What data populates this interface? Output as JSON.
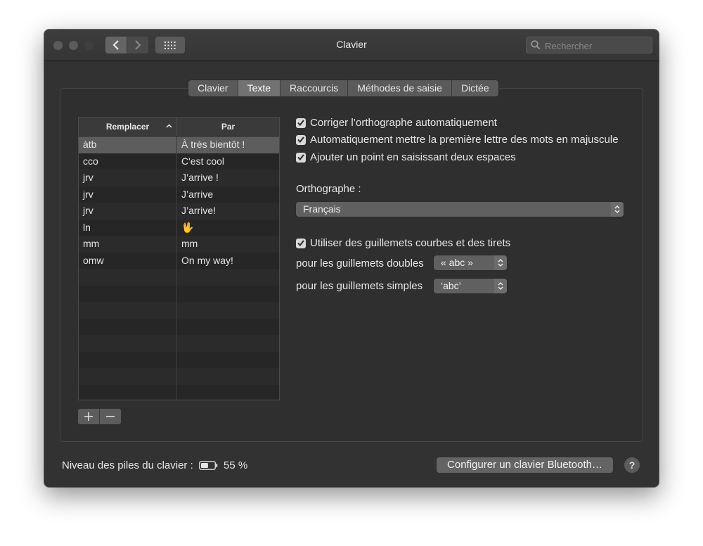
{
  "window": {
    "title": "Clavier"
  },
  "toolbar": {
    "search_placeholder": "Rechercher",
    "icons": [
      "chevron-left-icon",
      "chevron-right-icon",
      "grid-icon",
      "search-icon"
    ]
  },
  "tabs": [
    {
      "label": "Clavier",
      "active": false
    },
    {
      "label": "Texte",
      "active": true
    },
    {
      "label": "Raccourcis",
      "active": false
    },
    {
      "label": "Méthodes de saisie",
      "active": false
    },
    {
      "label": "Dictée",
      "active": false
    }
  ],
  "table": {
    "headers": {
      "replace": "Remplacer",
      "with": "Par"
    },
    "rows": [
      {
        "replace": "àtb",
        "with": "À très bientôt !",
        "selected": true
      },
      {
        "replace": "cco",
        "with": "C'est cool",
        "selected": false
      },
      {
        "replace": "jrv",
        "with": "J’arrive !",
        "selected": false
      },
      {
        "replace": "jrv",
        "with": "J’arrive",
        "selected": false
      },
      {
        "replace": "jrv",
        "with": "J’arrive!",
        "selected": false
      },
      {
        "replace": "ln",
        "with": "🖖",
        "selected": false
      },
      {
        "replace": "mm",
        "with": "mm",
        "selected": false
      },
      {
        "replace": "omw",
        "with": "On my way!",
        "selected": false
      }
    ]
  },
  "options": {
    "autocorrect": {
      "label": "Corriger l’orthographe automatiquement",
      "checked": true
    },
    "capitalize": {
      "label": "Automatiquement mettre la première lettre des mots en majuscule",
      "checked": true
    },
    "period": {
      "label": "Ajouter un point en saisissant deux espaces",
      "checked": true
    },
    "spelling_label": "Orthographe :",
    "spelling_value": "Français",
    "smart_quotes": {
      "label": "Utiliser des guillemets courbes et des tirets",
      "checked": true
    },
    "double_quotes_label": "pour les guillemets doubles",
    "double_quotes_value": "« abc »",
    "single_quotes_label": "pour les guillemets simples",
    "single_quotes_value": "‘abc’"
  },
  "footer": {
    "battery_label": "Niveau des piles du clavier :",
    "battery_value": "55 %",
    "battery_level": 0.55,
    "bluetooth_button": "Configurer un clavier Bluetooth…",
    "help": "?"
  },
  "colors": {
    "window_bg": "#323232",
    "selected_row": "#5d5d5d"
  }
}
